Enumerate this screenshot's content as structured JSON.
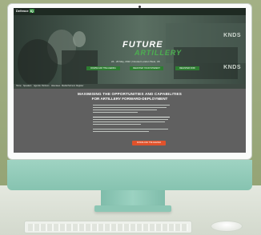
{
  "site": {
    "logo": "Defence",
    "logo_badge": "IQ"
  },
  "hero": {
    "title": "FUTURE",
    "subtitle": "ARTILLERY",
    "date": "24 - 26 May, 2022 | Novotel London West, UK",
    "buttons": [
      "DOWNLOAD THE AGENDA",
      "REGISTER YOUR INTEREST",
      "REGISTER NOW"
    ],
    "background_brand_text": "KNDS"
  },
  "nav": {
    "items": [
      "Home",
      "Speakers",
      "Agenda",
      "Partners",
      "Attendees",
      "Media Partners",
      "Register"
    ]
  },
  "content": {
    "heading_line1": "MAXIMISING THE OPPORTUNITIES AND CAPABILITIES",
    "heading_line2": "FOR ARTILLERY FORWARD-DEPLOYMENT",
    "cta": "DOWNLOAD THE AGENDA"
  },
  "colors": {
    "accent_green": "#4caf50",
    "button_green": "#2e7d32",
    "cta_orange": "#e0522b",
    "imac_green": "#9fd3c2",
    "wall": "#9aa87c"
  }
}
